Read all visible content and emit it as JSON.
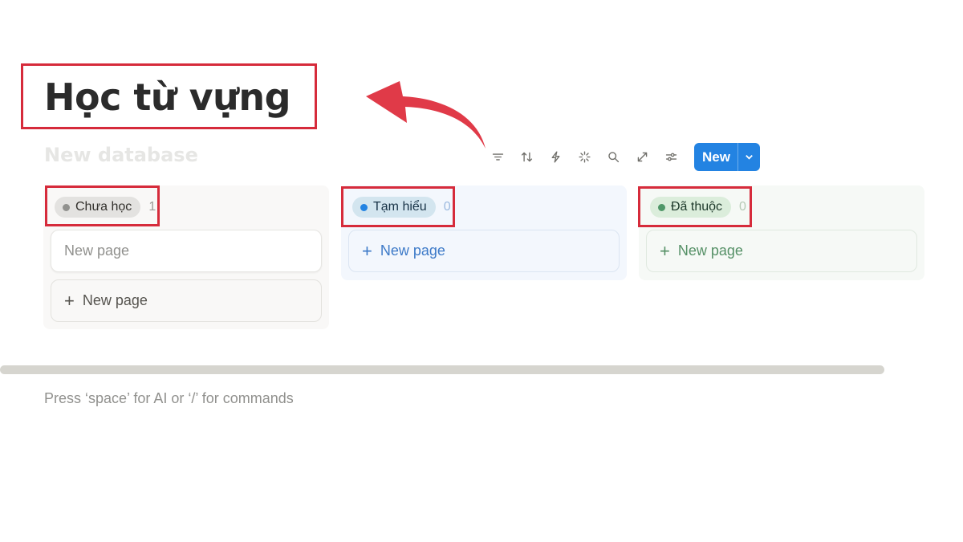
{
  "page": {
    "title": "Học từ vựng",
    "placeholder": "Press ‘space’ for AI or ‘/’ for commands"
  },
  "database": {
    "name": "New database"
  },
  "toolbar": {
    "icons": [
      "filter-icon",
      "sort-icon",
      "automation-icon",
      "ai-icon",
      "search-icon",
      "expand-icon",
      "settings-icon"
    ],
    "new_label": "New"
  },
  "board": {
    "columns": [
      {
        "label": "Chưa học",
        "count": "1",
        "color": "#91918e",
        "cards": [
          "New page"
        ],
        "add_label": "New page"
      },
      {
        "label": "Tạm hiểu",
        "count": "0",
        "color": "#2383e2",
        "cards": [],
        "add_label": "New page"
      },
      {
        "label": "Đã thuộc",
        "count": "0",
        "color": "#4f9768",
        "cards": [],
        "add_label": "New page"
      }
    ]
  },
  "colors": {
    "accent": "#2383e2",
    "annotation": "#d62b3b"
  }
}
